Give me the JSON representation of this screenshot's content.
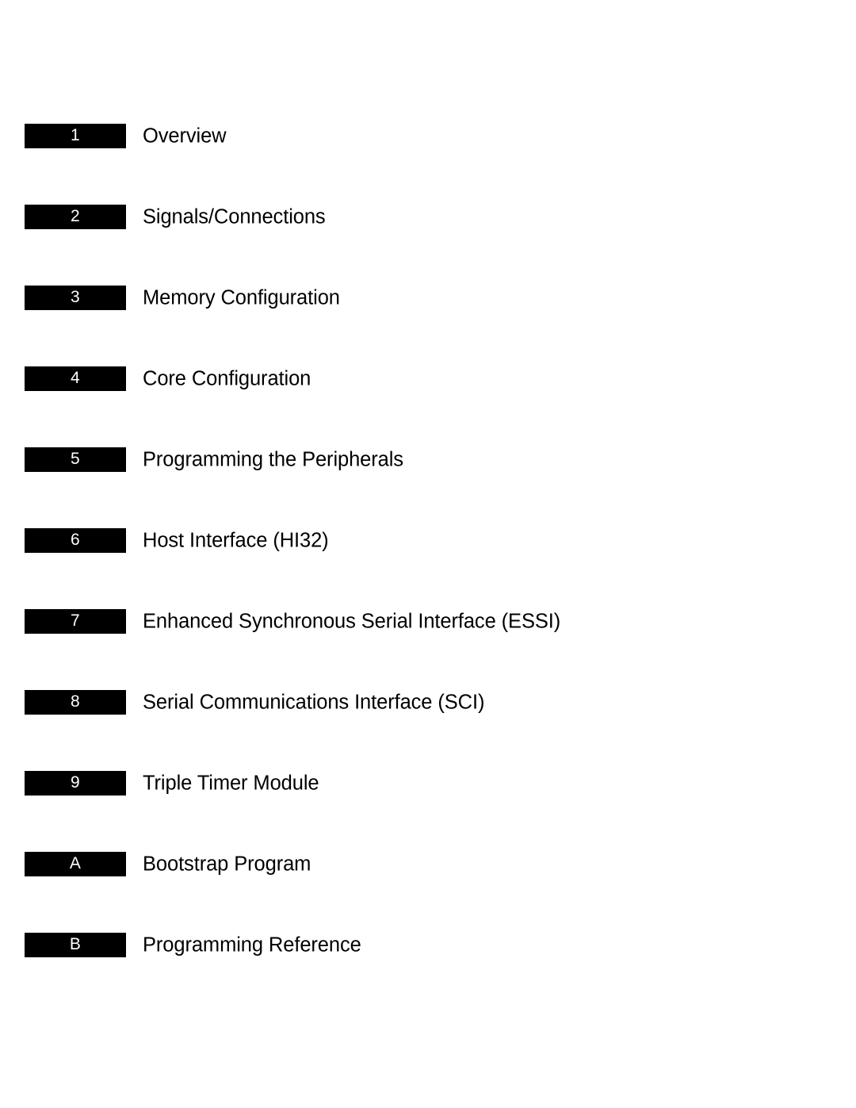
{
  "page": {
    "background_color": "#ffffff",
    "tab_color": "#000000",
    "tab_text_color": "#ffffff",
    "title_text_color": "#000000"
  },
  "chapters": [
    {
      "tab": "1",
      "title": "Overview"
    },
    {
      "tab": "2",
      "title": "Signals/Connections"
    },
    {
      "tab": "3",
      "title": "Memory Configuration"
    },
    {
      "tab": "4",
      "title": "Core Configuration"
    },
    {
      "tab": "5",
      "title": "Programming the Peripherals"
    },
    {
      "tab": "6",
      "title": "Host Interface (HI32)"
    },
    {
      "tab": "7",
      "title": "Enhanced Synchronous Serial Interface (ESSI)"
    },
    {
      "tab": "8",
      "title": "Serial Communications Interface (SCI)"
    },
    {
      "tab": "9",
      "title": "Triple Timer Module"
    },
    {
      "tab": "A",
      "title": "Bootstrap Program"
    },
    {
      "tab": "B",
      "title": "Programming Reference"
    }
  ]
}
